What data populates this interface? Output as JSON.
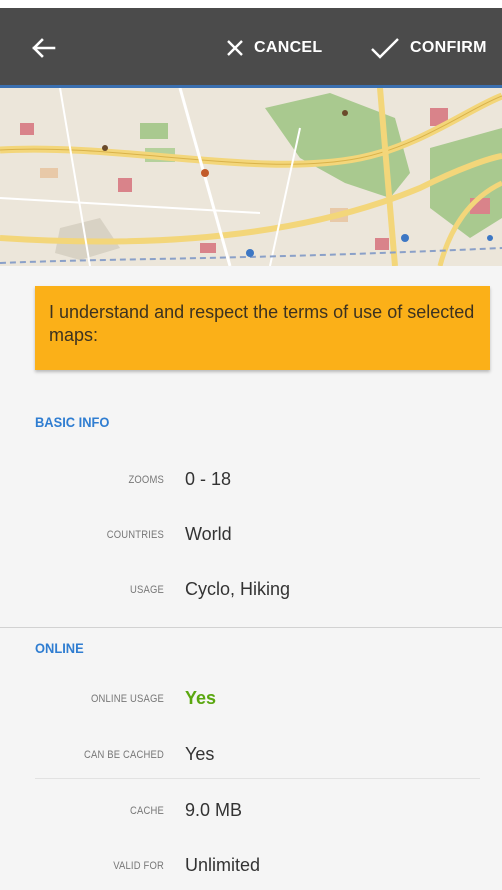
{
  "toolbar": {
    "back_icon": "arrow-left-icon",
    "cancel_icon": "close-icon",
    "cancel_label": "CANCEL",
    "confirm_icon": "check-icon",
    "confirm_label": "CONFIRM",
    "background": "#4b4b4b"
  },
  "terms": {
    "text": "I understand and respect the terms of use of selected maps:",
    "color": "#fbb018"
  },
  "basic_info": {
    "title": "BASIC INFO",
    "rows": [
      {
        "label": "ZOOMS",
        "value": "0 - 18"
      },
      {
        "label": "COUNTRIES",
        "value": "World"
      },
      {
        "label": "USAGE",
        "value": "Cyclo, Hiking"
      }
    ]
  },
  "online": {
    "title": "ONLINE",
    "rows": [
      {
        "label": "ONLINE USAGE",
        "value": "Yes"
      },
      {
        "label": "CAN BE CACHED",
        "value": "Yes"
      },
      {
        "label": "CACHE",
        "value": "9.0 MB"
      },
      {
        "label": "VALID FOR",
        "value": "Unlimited"
      }
    ]
  },
  "colors": {
    "section_title": "#2f7dd1",
    "yes_green": "#5aa70f"
  }
}
